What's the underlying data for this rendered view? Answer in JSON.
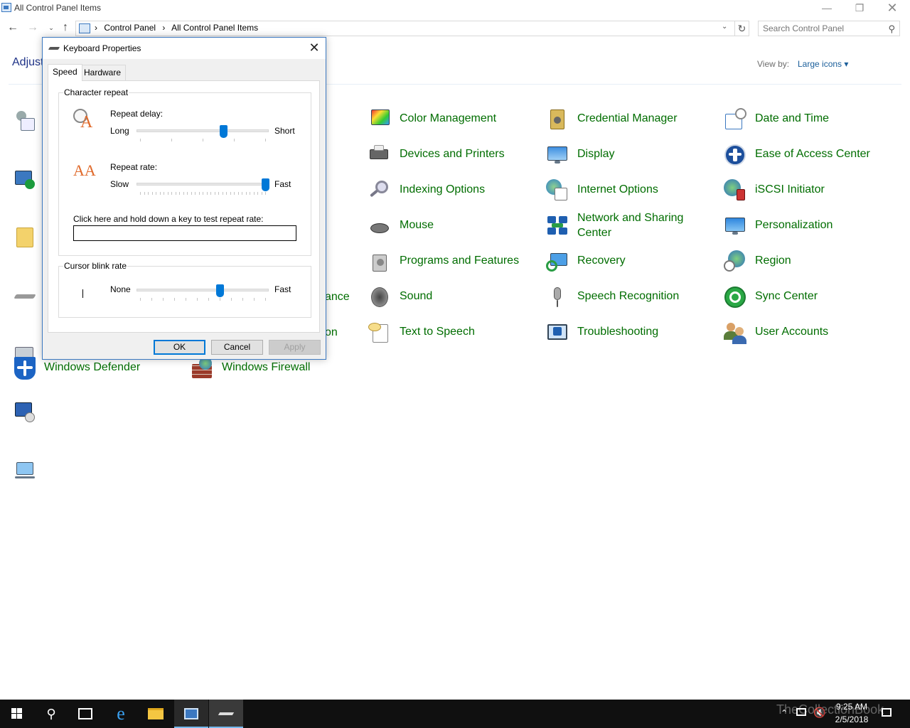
{
  "window": {
    "title": "All Control Panel Items"
  },
  "address": {
    "crumbs": [
      "Control Panel",
      "All Control Panel Items"
    ],
    "separator": "›"
  },
  "search": {
    "placeholder": "Search Control Panel"
  },
  "header": {
    "heading_partial": "Adjust",
    "viewby_label": "View by:",
    "viewby_value": "Large icons ▾"
  },
  "items": {
    "col3": [
      "Color Management",
      "Devices and Printers",
      "Indexing Options",
      "Mouse",
      "Programs and Features",
      "Sound",
      "Text to Speech"
    ],
    "col4": [
      "Credential Manager",
      "Display",
      "Internet Options",
      "Network and Sharing Center",
      "Recovery",
      "Speech Recognition",
      "Troubleshooting"
    ],
    "col5": [
      "Date and Time",
      "Ease of Access Center",
      "iSCSI Initiator",
      "Personalization",
      "Region",
      "Sync Center",
      "User Accounts"
    ],
    "row8": [
      "Windows Defender",
      "Windows Firewall"
    ],
    "col2_partial": [
      "ance",
      "on"
    ]
  },
  "dialog": {
    "title": "Keyboard Properties",
    "tabs": [
      "Speed",
      "Hardware"
    ],
    "character_repeat": {
      "group": "Character repeat",
      "delay_label": "Repeat delay:",
      "delay_min": "Long",
      "delay_max": "Short",
      "delay_value": 0.67,
      "rate_label": "Repeat rate:",
      "rate_min": "Slow",
      "rate_max": "Fast",
      "rate_value": 1.0,
      "test_label": "Click here and hold down a key to test repeat rate:"
    },
    "cursor": {
      "group": "Cursor blink rate",
      "min": "None",
      "max": "Fast",
      "value": 0.64
    },
    "buttons": {
      "ok": "OK",
      "cancel": "Cancel",
      "apply": "Apply"
    }
  },
  "taskbar": {
    "time": "9:25 AM",
    "date": "2/5/2018",
    "watermark": "TheCollectionBook"
  }
}
